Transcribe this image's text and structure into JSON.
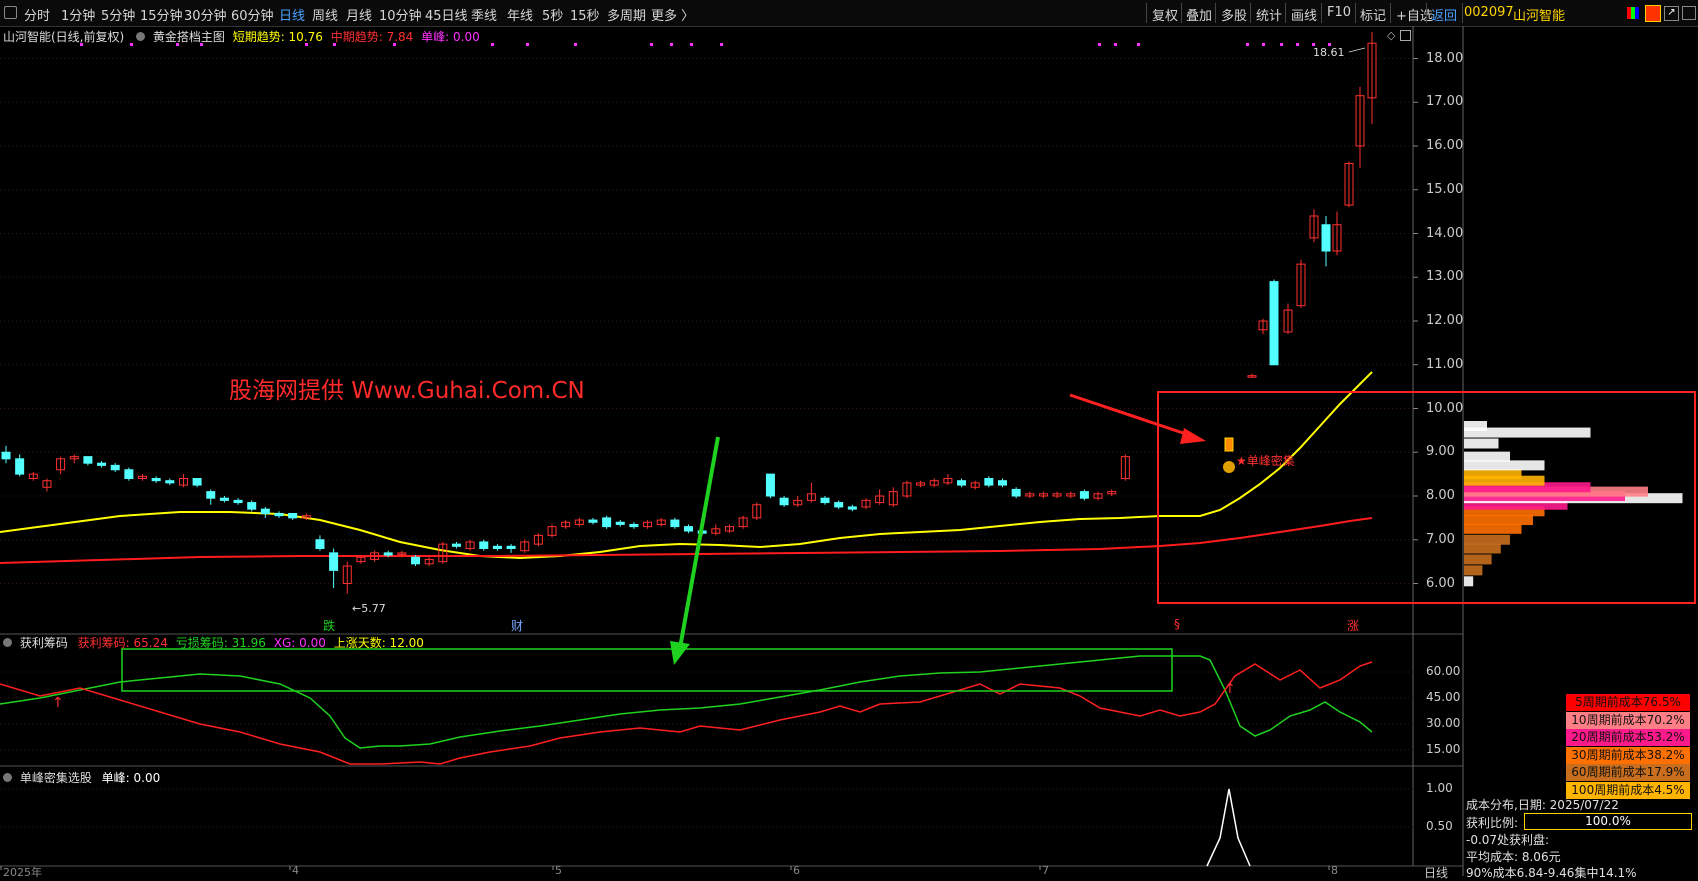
{
  "toolbar": {
    "periods": [
      "分时",
      "1分钟",
      "5分钟",
      "15分钟",
      "30分钟",
      "60分钟",
      "日线",
      "周线",
      "月线",
      "10分钟",
      "45日线",
      "季线",
      "年线",
      "5秒",
      "15秒",
      "多周期",
      "更多 〉"
    ],
    "active_period": "日线",
    "right_buttons": [
      "复权",
      "叠加",
      "多股",
      "统计",
      "画线",
      "F10",
      "标记",
      "+自选",
      "返回"
    ],
    "stock_code": "002097",
    "stock_name": "山河智能"
  },
  "main_chart": {
    "title": "山河智能(日线,前复权)",
    "indicator_name": "黄金搭档主图",
    "short_trend_label": "短期趋势: 10.76",
    "mid_trend_label": "中期趋势: 7.84",
    "single_peak_label": "单峰: 0.00",
    "price_axis": [
      "18.00",
      "17.00",
      "16.00",
      "15.00",
      "14.00",
      "13.00",
      "12.00",
      "11.00",
      "10.00",
      "9.00",
      "8.00",
      "7.00",
      "6.00"
    ],
    "high_label": "18.61",
    "low_label": "5.77",
    "annotation": "单峰密集",
    "event_markers": [
      "跌",
      "财",
      "§",
      "涨"
    ],
    "watermark": "股海网提供 Www.Guhai.Com.CN"
  },
  "sub_chart1": {
    "name": "获利筹码",
    "profit_label": "获利筹码: 65.24",
    "loss_label": "亏损筹码: 31.96",
    "xg_label": "XG: 0.00",
    "up_days_label": "上涨天数: 12.00",
    "axis": [
      "60.00",
      "45.00",
      "30.00",
      "15.00"
    ]
  },
  "sub_chart2": {
    "name": "单峰密集选股",
    "value_label": "单峰: 0.00",
    "axis": [
      "1.00",
      "0.50"
    ]
  },
  "date_axis": [
    "2025年",
    "4",
    "5",
    "6",
    "7",
    "8"
  ],
  "date_axis_right": "日线",
  "cost_panel": {
    "items": [
      {
        "label": "5周期前成本76.5%",
        "color": "#ff0000"
      },
      {
        "label": "10周期前成本70.2%",
        "color": "#ff7f86"
      },
      {
        "label": "20周期前成本53.2%",
        "color": "#ff1a8c"
      },
      {
        "label": "30周期前成本38.2%",
        "color": "#ff7000"
      },
      {
        "label": "60周期前成本17.9%",
        "color": "#c86e1e"
      },
      {
        "label": "100周期前成本4.5%",
        "color": "#ffb400"
      }
    ],
    "date_line": "成本分布,日期: 2025/07/22",
    "profit_ratio_label": "获利比例:",
    "profit_ratio_value": "100.0%",
    "profit_line": "-0.07处获利盘:",
    "avg_cost_line": "平均成本: 8.06元",
    "cost90_line": "90%成本6.84-9.46集中14.1%"
  },
  "colors": {
    "up": "#ff3030",
    "down": "#54ffff",
    "short_trend": "#ffff00",
    "mid_trend": "#ff1c1c",
    "profit_line": "#ff2020",
    "loss_line": "#1fd21f"
  }
}
